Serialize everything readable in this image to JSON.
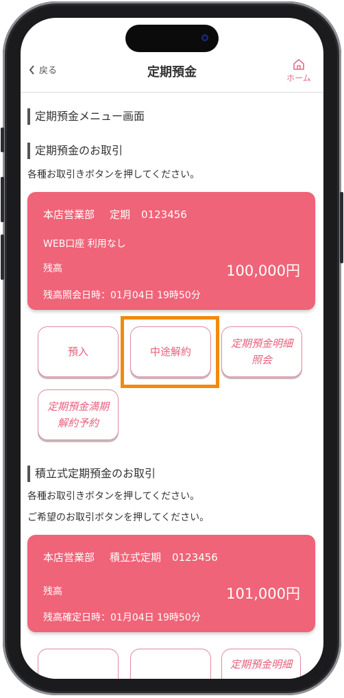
{
  "nav": {
    "back_label": "戻る",
    "title": "定期預金",
    "home_label": "ホーム"
  },
  "page": {
    "menu_title": "定期預金メニュー画面",
    "section1": {
      "title": "定期預金のお取引",
      "note": "各種お取引きボタンを押してください。",
      "card": {
        "branch": "本店営業部",
        "type": "定期",
        "account": "0123456",
        "web": "WEB口座 利用なし",
        "balance_label": "残高",
        "balance": "100,000円",
        "date": "残高照会日時：01月04日 19時50分"
      },
      "buttons": [
        "預入",
        "中途解約",
        "定期預金明細照会",
        "定期預金満期解約予約"
      ]
    },
    "section2": {
      "title": "積立式定期預金のお取引",
      "note1": "各種お取引きボタンを押してください。",
      "note2": "ご希望のお取引ボタンを押してください。",
      "card": {
        "branch": "本店営業部",
        "type": "積立式定期",
        "account": "0123456",
        "balance_label": "残高",
        "balance": "101,000円",
        "date": "残高確定日時：01月04日 19時50分"
      },
      "buttons_partial": [
        "定期預金明細"
      ]
    }
  },
  "colors": {
    "card": "#ef6478",
    "accent": "#e8607b",
    "highlight": "#f28a0f"
  }
}
